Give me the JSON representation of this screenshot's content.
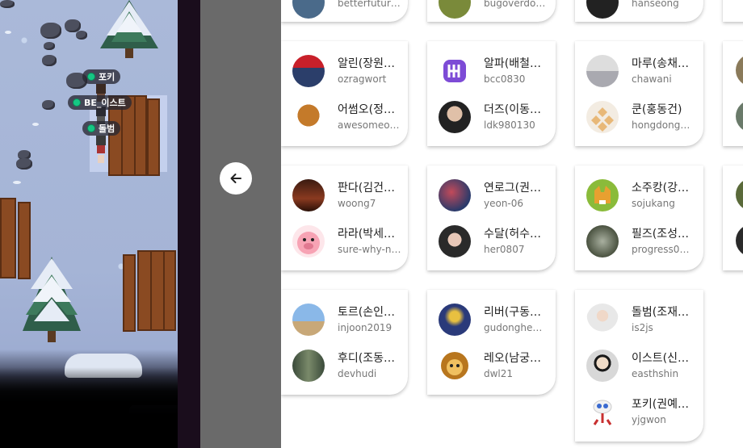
{
  "game": {
    "players": [
      {
        "tag": "포키"
      },
      {
        "tag": "BE_이스트"
      },
      {
        "tag": "돌범"
      }
    ],
    "current_user": "돌범"
  },
  "members": {
    "row0": [
      {
        "name": "",
        "id": "betterfutur…"
      },
      {
        "name": "",
        "id": "bugoverdo…"
      },
      {
        "name": "",
        "id": "hanseong"
      }
    ],
    "cards": [
      [
        {
          "name": "알린(장원…",
          "id": "ozragwort"
        },
        {
          "name": "어썸오(정…",
          "id": "awesomeo…"
        }
      ],
      [
        {
          "name": "알파(배철…",
          "id": "bcc0830"
        },
        {
          "name": "더즈(이동…",
          "id": "ldk980130"
        }
      ],
      [
        {
          "name": "마루(송채…",
          "id": "chawani"
        },
        {
          "name": "쿤(홍동건)",
          "id": "hongdong…"
        }
      ],
      [
        {
          "name": "판다(김건…",
          "id": "woong7"
        },
        {
          "name": "라라(박세…",
          "id": "sure-why-n…"
        }
      ],
      [
        {
          "name": "연로그(권…",
          "id": "yeon-06"
        },
        {
          "name": "수달(허수…",
          "id": "her0807"
        }
      ],
      [
        {
          "name": "소주캉(강…",
          "id": "sojukang"
        },
        {
          "name": "필즈(조성…",
          "id": "progress0…"
        }
      ],
      [
        {
          "name": "토르(손인…",
          "id": "injoon2019"
        },
        {
          "name": "후디(조동…",
          "id": "devhudi"
        }
      ],
      [
        {
          "name": "리버(구동…",
          "id": "gudonghe…"
        },
        {
          "name": "레오(남궁…",
          "id": "dwl21"
        }
      ],
      [
        {
          "name": "돌범(조재…",
          "id": "is2js"
        },
        {
          "name": "이스트(신…",
          "id": "easthshin"
        },
        {
          "name": "포키(권예…",
          "id": "yjgwon"
        }
      ]
    ]
  },
  "colors": {
    "online": "#16c784",
    "game_bg": "#a5b4d6",
    "overlay": "#6a6a6a"
  },
  "icons": {
    "collapse": "arrow-left-icon"
  }
}
